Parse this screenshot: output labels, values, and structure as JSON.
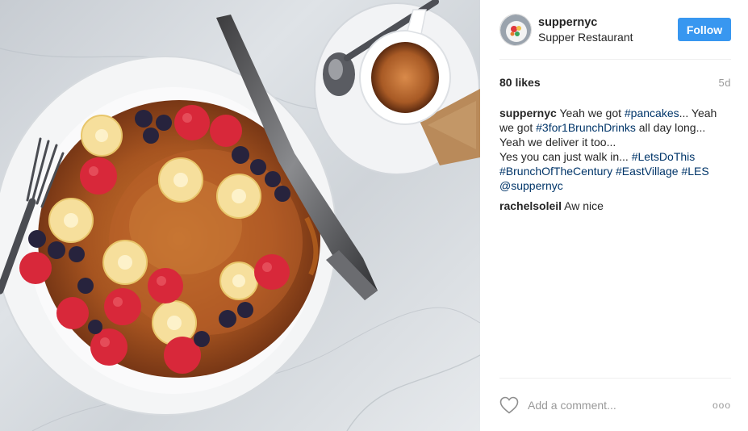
{
  "account": {
    "username": "suppernyc",
    "location": "Supper Restaurant",
    "follow_label": "Follow"
  },
  "post": {
    "likes": "80 likes",
    "time": "5d",
    "caption_user": "suppernyc",
    "caption_parts": [
      {
        "text": " Yeah we got ",
        "tag": false
      },
      {
        "text": "#pancakes",
        "tag": true
      },
      {
        "text": "... Yeah we got ",
        "tag": false
      },
      {
        "text": "#3for1BrunchDrinks",
        "tag": true
      },
      {
        "text": " all day long... Yeah we deliver it too...",
        "tag": false
      },
      {
        "text": "\n",
        "tag": false
      },
      {
        "text": "Yes you can just walk in... ",
        "tag": false
      },
      {
        "text": "#LetsDoThis",
        "tag": true
      },
      {
        "text": " ",
        "tag": false
      },
      {
        "text": "#BrunchOfTheCentury",
        "tag": true
      },
      {
        "text": " ",
        "tag": false
      },
      {
        "text": "#EastVillage",
        "tag": true
      },
      {
        "text": " ",
        "tag": false
      },
      {
        "text": "#LES",
        "tag": true
      },
      {
        "text": " ",
        "tag": false
      },
      {
        "text": "@suppernyc",
        "tag": true
      }
    ],
    "comments": [
      {
        "user": "rachelsoleil",
        "text": " Aw nice"
      }
    ]
  },
  "footer": {
    "comment_placeholder": "Add a comment...",
    "more_label": "ooo"
  },
  "icons": {
    "like": "heart-outline-icon",
    "more": "ellipsis-icon"
  },
  "colors": {
    "follow_button": "#3897f0",
    "hashtag": "#003569",
    "muted": "#999999"
  }
}
